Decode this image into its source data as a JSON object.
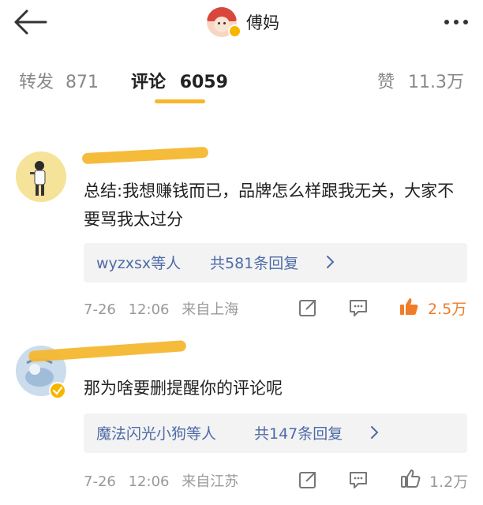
{
  "header": {
    "title": "傅妈"
  },
  "tabs": {
    "repost": {
      "label": "转发",
      "count": "871"
    },
    "comment": {
      "label": "评论",
      "count": "6059"
    },
    "like": {
      "label": "赞",
      "count": "11.3万"
    }
  },
  "sort": {
    "label": ""
  },
  "comments": [
    {
      "username": "",
      "text": "总结:我想赚钱而已，品牌怎么样跟我无关，大家不要骂我太过分",
      "reply_users": "wyzxsx等人",
      "reply_count": "共581条回复",
      "date": "7-26",
      "time": "12:06",
      "location": "来自上海",
      "likes": "2.5万",
      "liked": true,
      "accent_color": "#f07c2a"
    },
    {
      "username": "",
      "text": "那为啥要删提醒你的评论呢",
      "reply_users": "魔法闪光小狗等人",
      "reply_count": "共147条回复",
      "date": "7-26",
      "time": "12:06",
      "location": "来自江苏",
      "likes": "1.2万",
      "liked": false,
      "accent_color": "#999999"
    }
  ],
  "icons": {
    "back": "arrow-left-icon",
    "more": "more-dots-icon",
    "repost": "repost-icon",
    "comment": "comment-bubble-icon",
    "like": "thumbs-up-icon"
  }
}
